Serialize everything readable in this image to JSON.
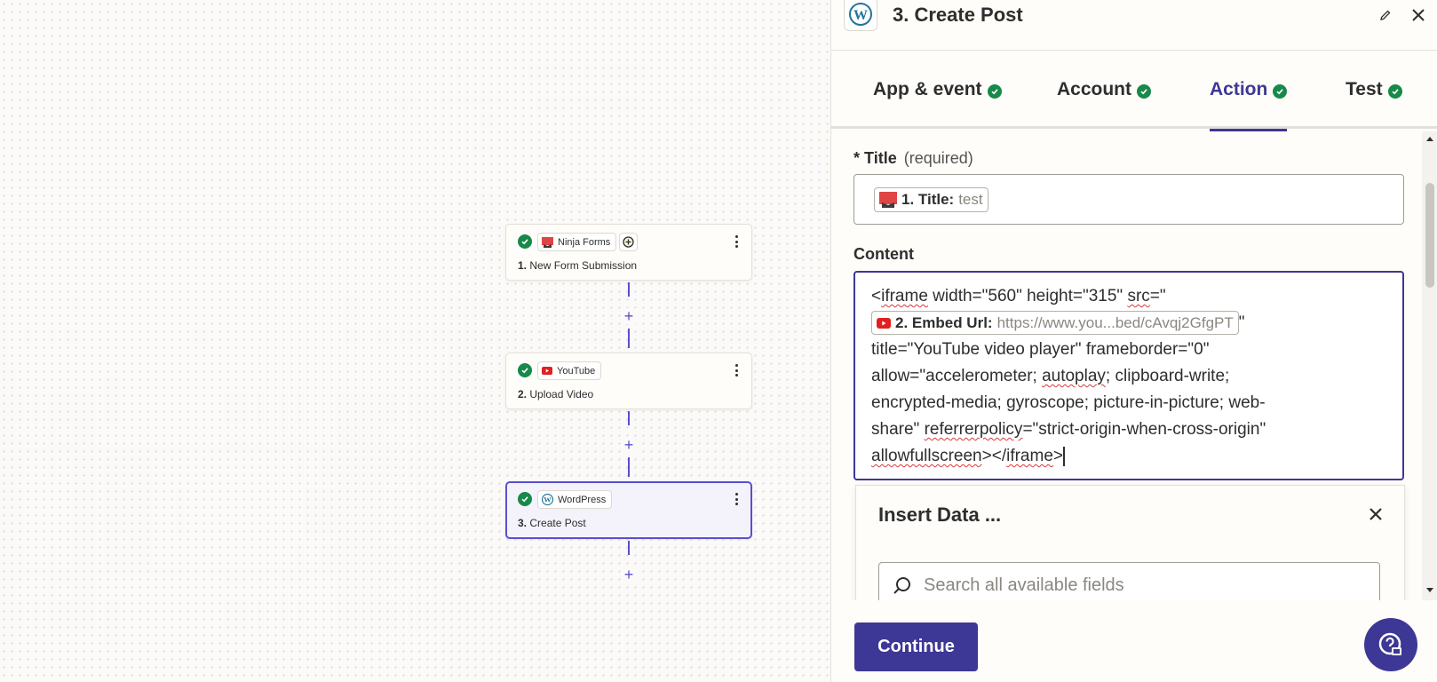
{
  "canvas": {
    "steps": [
      {
        "app": "Ninja Forms",
        "number": "1.",
        "name": "New Form Submission"
      },
      {
        "app": "YouTube",
        "number": "2.",
        "name": "Upload Video"
      },
      {
        "app": "WordPress",
        "number": "3.",
        "name": "Create Post"
      }
    ],
    "plus": "+"
  },
  "panel": {
    "title": "3. Create Post",
    "tabs": [
      "App & event",
      "Account",
      "Action",
      "Test"
    ],
    "active_tab": "Action",
    "title_field": {
      "label": "Title",
      "required_marker": "*",
      "required_text": "(required)",
      "pill_label": "1. Title:",
      "pill_value": "test"
    },
    "content_field": {
      "label": "Content",
      "text_before": "<iframe width=\"560\" height=\"315\" src=\"",
      "pill_label": "2. Embed Url:",
      "pill_value": "https://www.you...bed/cAvqj2GfgPT",
      "text_quote": "\"",
      "line3": "title=\"YouTube video player\" frameborder=\"0\"",
      "line4_a": "allow=\"accelerometer; ",
      "line4_b": "autoplay",
      "line4_c": "; clipboard-write;",
      "line5": "encrypted-media; gyroscope; picture-in-picture; web-",
      "line6_a": "share\" ",
      "line6_b": "referrerpolicy",
      "line6_c": "=\"strict-origin-when-cross-origin\"",
      "line7_a": "allowfullscreen",
      "line7_b": "></",
      "line7_c": "iframe",
      "line7_d": ">"
    },
    "insert_data": {
      "title": "Insert Data ...",
      "search_placeholder": "Search all available fields"
    },
    "continue_label": "Continue"
  },
  "colors": {
    "accent": "#3d3796",
    "success": "#16894b",
    "selected_border": "#5a4fcf"
  },
  "icons": [
    "check-icon",
    "ninja-forms-icon",
    "youtube-icon",
    "wordpress-icon",
    "pencil-icon",
    "close-icon",
    "search-icon",
    "help-icon",
    "more-icon",
    "add-icon"
  ]
}
